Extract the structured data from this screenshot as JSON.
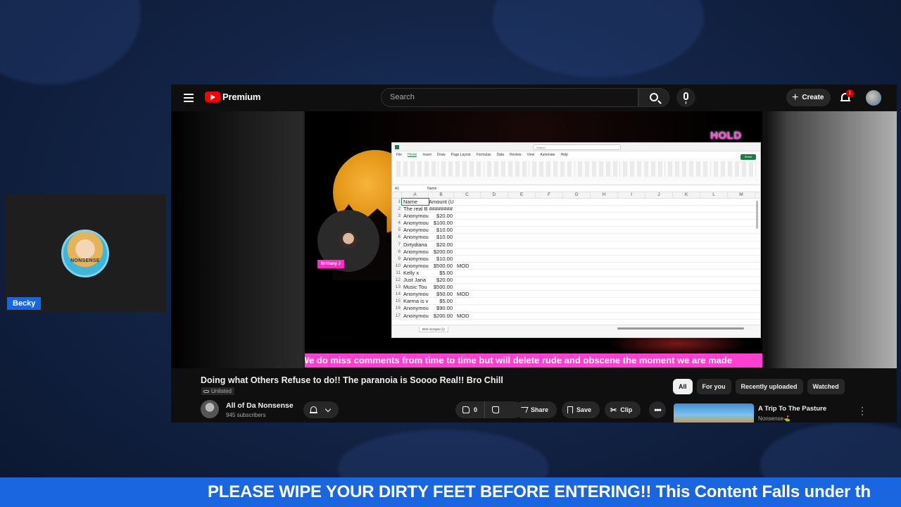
{
  "webcam": {
    "name": "Becky",
    "avatar_text": "NONSENSE"
  },
  "youtube": {
    "logo_text": "Premium",
    "search_placeholder": "Search",
    "create_label": "Create",
    "notification_count": "1"
  },
  "video": {
    "overlay_hold": "HOLD",
    "guest_name": "Brittany J",
    "marquee": "We do miss comments from time to time but will delete rude and obscene the moment we are made",
    "excel": {
      "search": "Search",
      "share": "Share",
      "tabs": [
        "File",
        "Home",
        "Insert",
        "Draw",
        "Page Layout",
        "Formulas",
        "Data",
        "Review",
        "View",
        "Automate",
        "Help"
      ],
      "cell_ref": "A1",
      "formula": "Name",
      "columns": [
        "A",
        "B",
        "C",
        "D",
        "E",
        "F",
        "G",
        "H",
        "I",
        "J",
        "K",
        "L",
        "M"
      ],
      "rows": [
        {
          "n": "1",
          "a": "Name",
          "b": "Amount (USD)",
          "c": ""
        },
        {
          "n": "2",
          "a": "The real B",
          "b": "########",
          "c": ""
        },
        {
          "n": "3",
          "a": "Anonymou",
          "b": "$20.00",
          "c": ""
        },
        {
          "n": "4",
          "a": "Anonymou",
          "b": "$100.00",
          "c": ""
        },
        {
          "n": "5",
          "a": "Anonymou",
          "b": "$10.00",
          "c": ""
        },
        {
          "n": "6",
          "a": "Anonymou",
          "b": "$10.00",
          "c": ""
        },
        {
          "n": "7",
          "a": "Dirtydiana",
          "b": "$20.00",
          "c": ""
        },
        {
          "n": "8",
          "a": "Anonymou",
          "b": "$200.00",
          "c": ""
        },
        {
          "n": "9",
          "a": "Anonymou",
          "b": "$10.00",
          "c": ""
        },
        {
          "n": "10",
          "a": "Anonymou",
          "b": "$500.00",
          "c": "MOD"
        },
        {
          "n": "11",
          "a": "Kelly x",
          "b": "$5.00",
          "c": ""
        },
        {
          "n": "12",
          "a": "Just Jana",
          "b": "$20.00",
          "c": ""
        },
        {
          "n": "13",
          "a": "Music Tou",
          "b": "$500.00",
          "c": ""
        },
        {
          "n": "14",
          "a": "Anonymou",
          "b": "$50.00",
          "c": "MOD"
        },
        {
          "n": "15",
          "a": "Karma is v",
          "b": "$5.00",
          "c": ""
        },
        {
          "n": "16",
          "a": "Anonymou",
          "b": "$90.00",
          "c": ""
        },
        {
          "n": "17",
          "a": "Anonymou",
          "b": "$200.00",
          "c": "MOD"
        }
      ],
      "sheet_tab": "Brbl receipts (1)"
    }
  },
  "info": {
    "title": "Doing what Others Refuse to do!! The paranoia is Soooo Real!! Bro Chill",
    "visibility": "Unlisted",
    "channel": "All of Da Nonsense",
    "subscribers": "945 subscribers",
    "likes": "0",
    "share": "Share",
    "save": "Save",
    "clip": "Clip"
  },
  "chips": [
    "All",
    "For you",
    "Recently uploaded",
    "Watched"
  ],
  "recommendation": {
    "title": "A Trip To The Pasture",
    "channel": "Nonsense⛳"
  },
  "ticker": "PLEASE WIPE YOUR DIRTY FEET BEFORE ENTERING!! This Content Falls under th",
  "colors": {
    "ticker_bg": "#1a66e0",
    "marquee_bg": "#ff3fd0",
    "yt_red": "#ff0000"
  }
}
